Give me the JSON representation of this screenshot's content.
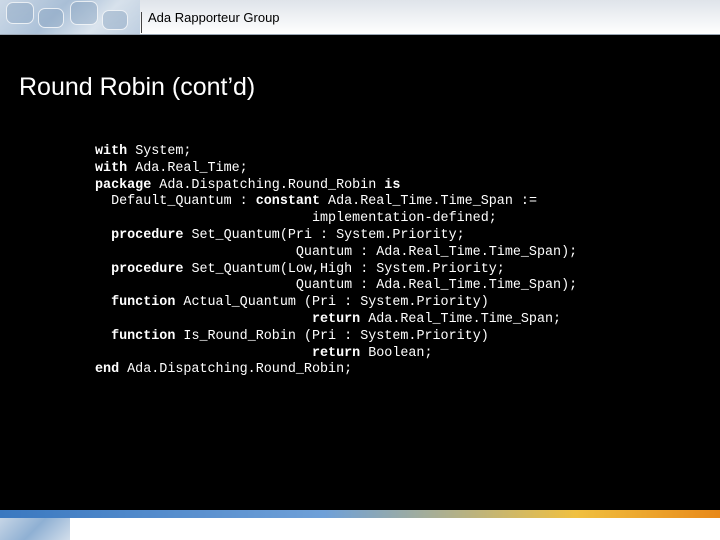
{
  "header": {
    "group_name": "Ada Rapporteur Group"
  },
  "slide": {
    "title": "Round Robin (cont’d)"
  },
  "code": {
    "lines": [
      [
        {
          "kw": "with"
        },
        {
          "t": " System;"
        }
      ],
      [
        {
          "kw": "with"
        },
        {
          "t": " Ada.Real_Time;"
        }
      ],
      [
        {
          "kw": "package"
        },
        {
          "t": " Ada.Dispatching.Round_Robin "
        },
        {
          "kw": "is"
        }
      ],
      [
        {
          "t": "  Default_Quantum : "
        },
        {
          "kw": "constant"
        },
        {
          "t": " Ada.Real_Time.Time_Span :="
        }
      ],
      [
        {
          "t": "                           implementation-defined;"
        }
      ],
      [
        {
          "t": "  "
        },
        {
          "kw": "procedure"
        },
        {
          "t": " Set_Quantum(Pri : System.Priority;"
        }
      ],
      [
        {
          "t": "                         Quantum : Ada.Real_Time.Time_Span);"
        }
      ],
      [
        {
          "t": "  "
        },
        {
          "kw": "procedure"
        },
        {
          "t": " Set_Quantum(Low,High : System.Priority;"
        }
      ],
      [
        {
          "t": "                         Quantum : Ada.Real_Time.Time_Span);"
        }
      ],
      [
        {
          "t": "  "
        },
        {
          "kw": "function"
        },
        {
          "t": " Actual_Quantum (Pri : System.Priority)"
        }
      ],
      [
        {
          "t": "                           "
        },
        {
          "kw": "return"
        },
        {
          "t": " Ada.Real_Time.Time_Span;"
        }
      ],
      [
        {
          "t": "  "
        },
        {
          "kw": "function"
        },
        {
          "t": " Is_Round_Robin (Pri : System.Priority)"
        }
      ],
      [
        {
          "t": "                           "
        },
        {
          "kw": "return"
        },
        {
          "t": " Boolean;"
        }
      ],
      [
        {
          "kw": "end"
        },
        {
          "t": " Ada.Dispatching.Round_Robin;"
        }
      ]
    ]
  }
}
